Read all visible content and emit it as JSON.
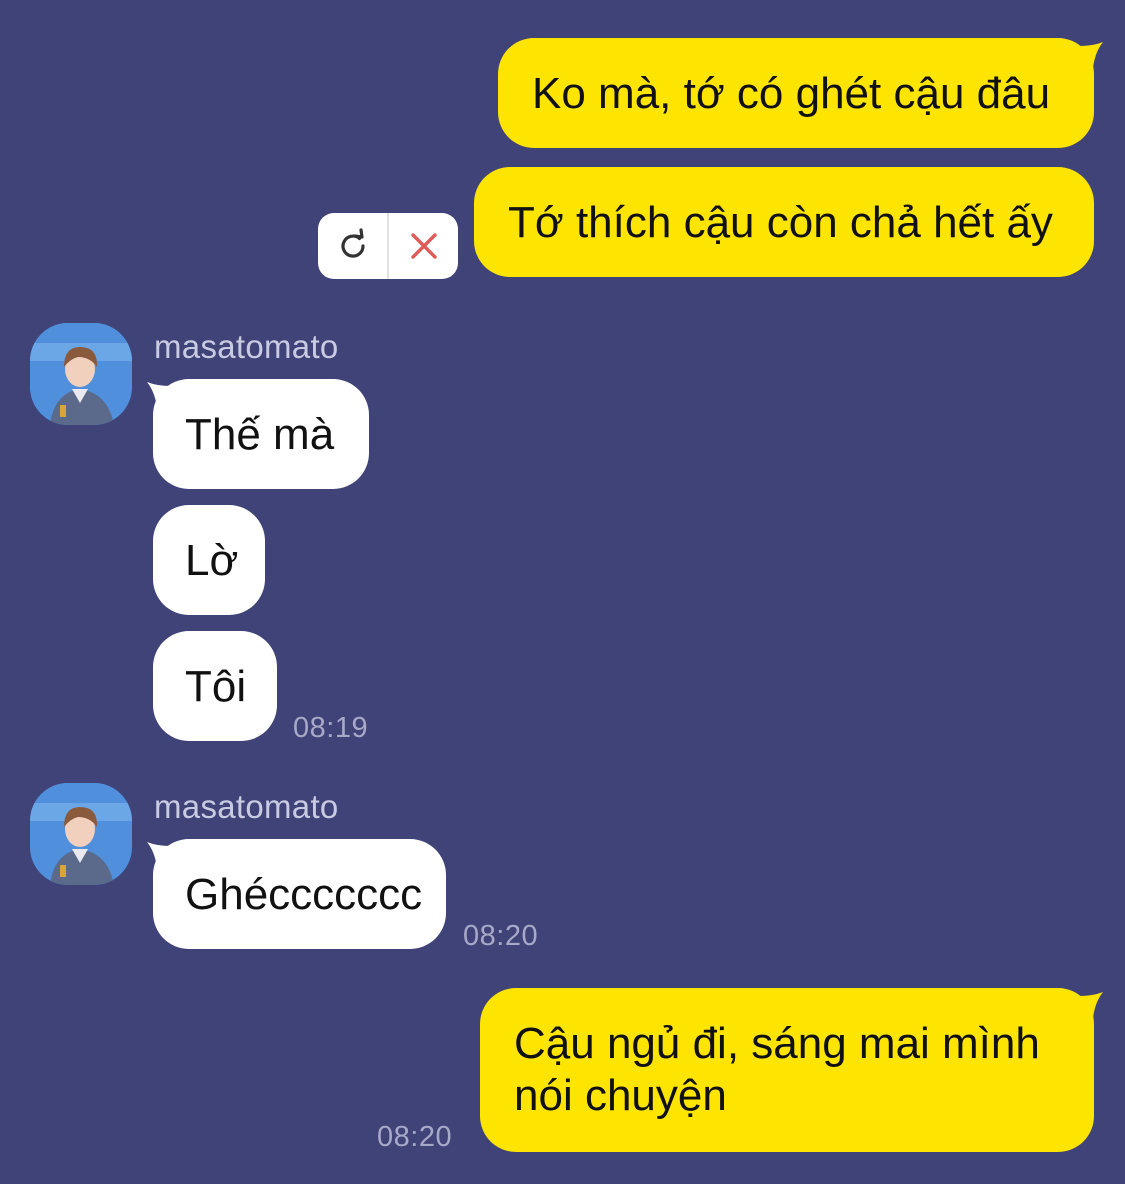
{
  "colors": {
    "background": "#404377",
    "outgoing_bubble": "#FDE401",
    "incoming_bubble": "#FFFFFF",
    "timestamp": "#A7A9C8",
    "retry_icon": "#333333",
    "delete_icon": "#E05A5A"
  },
  "messages": {
    "out_1": {
      "text": "Ko mà, tớ có ghét cậu đâu"
    },
    "out_2": {
      "text": "Tớ thích cậu còn chả hết ấy",
      "status": "failed"
    },
    "failed_actions": {
      "retry_icon": "retry-icon",
      "delete_icon": "close-icon"
    },
    "group_1": {
      "sender": "masatomato",
      "lines": [
        "Thế mà",
        "Lờ",
        "Tôi"
      ],
      "time": "08:19"
    },
    "group_2": {
      "sender": "masatomato",
      "lines": [
        "Ghéccccccc"
      ],
      "time": "08:20"
    },
    "out_3": {
      "line1": "Cậu ngủ đi, sáng mai mình",
      "line2": "nói chuyện",
      "time": "08:20"
    }
  }
}
